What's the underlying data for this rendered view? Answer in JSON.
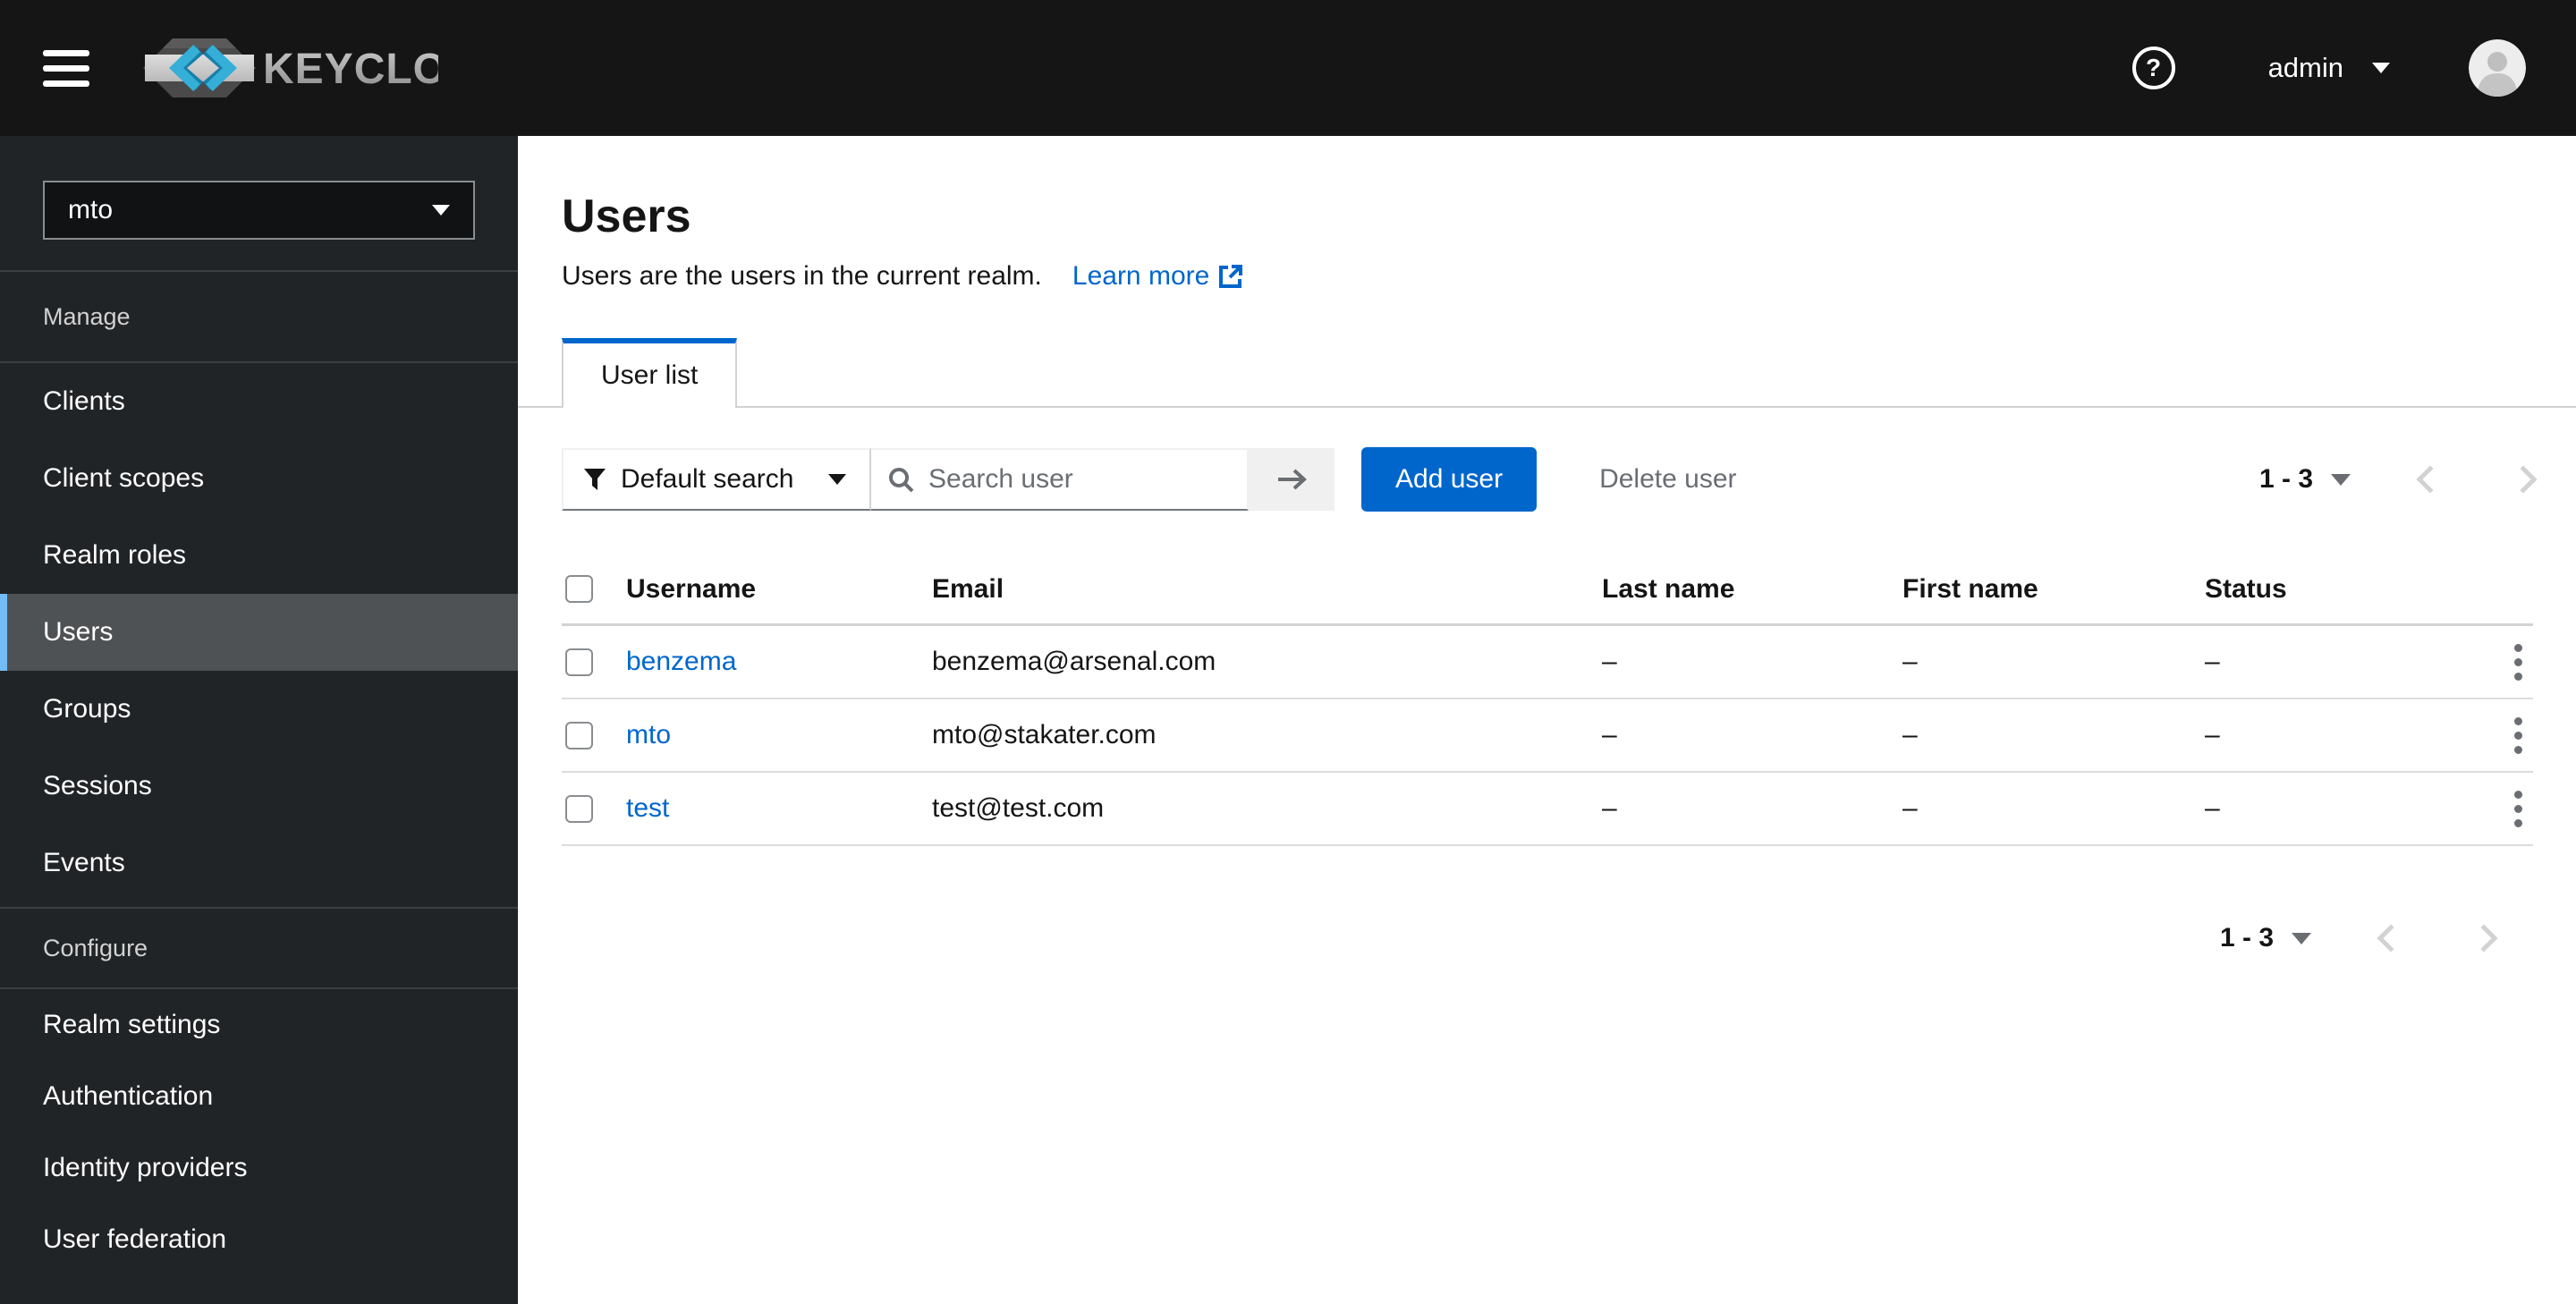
{
  "header": {
    "brand": "KEYCLOAK",
    "user_label": "admin"
  },
  "sidebar": {
    "realm_selector": {
      "value": "mto"
    },
    "sections": [
      {
        "label": "Manage",
        "items": [
          {
            "label": "Clients"
          },
          {
            "label": "Client scopes"
          },
          {
            "label": "Realm roles"
          },
          {
            "label": "Users",
            "selected": true
          },
          {
            "label": "Groups"
          },
          {
            "label": "Sessions"
          },
          {
            "label": "Events"
          }
        ]
      },
      {
        "label": "Configure",
        "items": [
          {
            "label": "Realm settings"
          },
          {
            "label": "Authentication"
          },
          {
            "label": "Identity providers"
          },
          {
            "label": "User federation"
          }
        ]
      }
    ]
  },
  "page": {
    "title": "Users",
    "subtitle": "Users are the users in the current realm.",
    "learn_more_label": "Learn more",
    "tabs": [
      {
        "label": "User list",
        "active": true
      }
    ]
  },
  "toolbar": {
    "filter_label": "Default search",
    "search_placeholder": "Search user",
    "add_user_label": "Add user",
    "delete_user_label": "Delete user",
    "pagination_label": "1 - 3"
  },
  "table": {
    "columns": [
      "Username",
      "Email",
      "Last name",
      "First name",
      "Status"
    ],
    "rows": [
      {
        "username": "benzema",
        "email": "benzema@arsenal.com",
        "last_name": "–",
        "first_name": "–",
        "status": "–"
      },
      {
        "username": "mto",
        "email": "mto@stakater.com",
        "last_name": "–",
        "first_name": "–",
        "status": "–"
      },
      {
        "username": "test",
        "email": "test@test.com",
        "last_name": "–",
        "first_name": "–",
        "status": "–"
      }
    ]
  },
  "footer": {
    "pagination_label": "1 - 3"
  },
  "colors": {
    "masthead": "#151515",
    "sidebar": "#212427",
    "nav_selected": "#4f5255",
    "nav_accent": "#73bcf7",
    "primary": "#0066cc",
    "link": "#0066cc",
    "muted_text": "#6a6e73",
    "border": "#d2d2d2",
    "brand_blue": "#35aed8"
  }
}
